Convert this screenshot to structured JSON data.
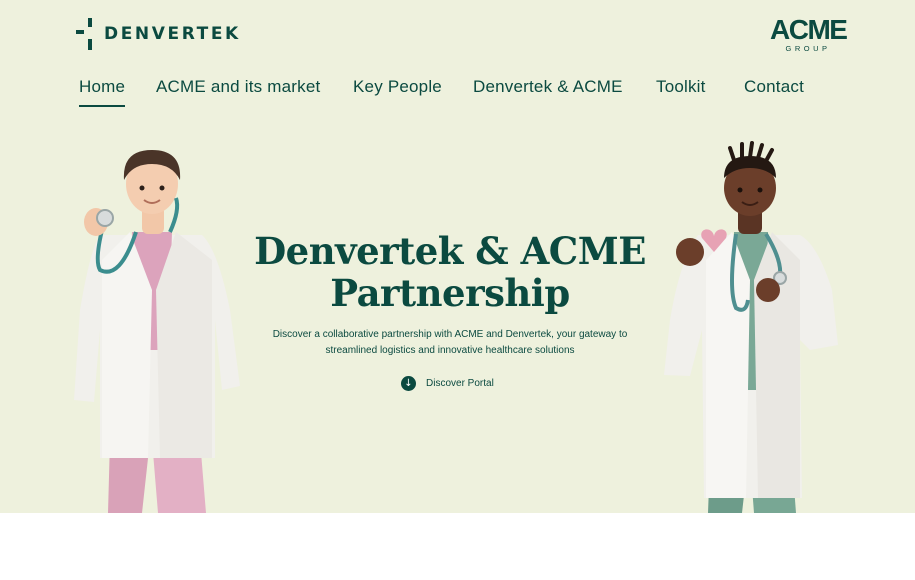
{
  "brand": {
    "denvertek": "DENVERTEK",
    "acme_logo": "ACME",
    "acme_sub": "GROUP"
  },
  "nav": {
    "items": [
      {
        "label": "Home",
        "active": true
      },
      {
        "label": "ACME and its market",
        "active": false
      },
      {
        "label": "Key People",
        "active": false
      },
      {
        "label": "Denvertek & ACME",
        "active": false
      },
      {
        "label": "Toolkit",
        "active": false
      },
      {
        "label": "Contact",
        "active": false
      }
    ]
  },
  "hero": {
    "title_line1": "Denvertek & ACME",
    "title_line2": "Partnership",
    "subtitle_line1": "Discover a collaborative partnership with ACME and Denvertek, your gateway to",
    "subtitle_line2": "streamlined logistics and innovative healthcare solutions",
    "cta_label": "Discover Portal",
    "cta_icon": "arrow-down-icon"
  },
  "colors": {
    "brand_green": "#0b4a40",
    "hero_background": "#eef1dd",
    "page_background": "#ffffff"
  }
}
